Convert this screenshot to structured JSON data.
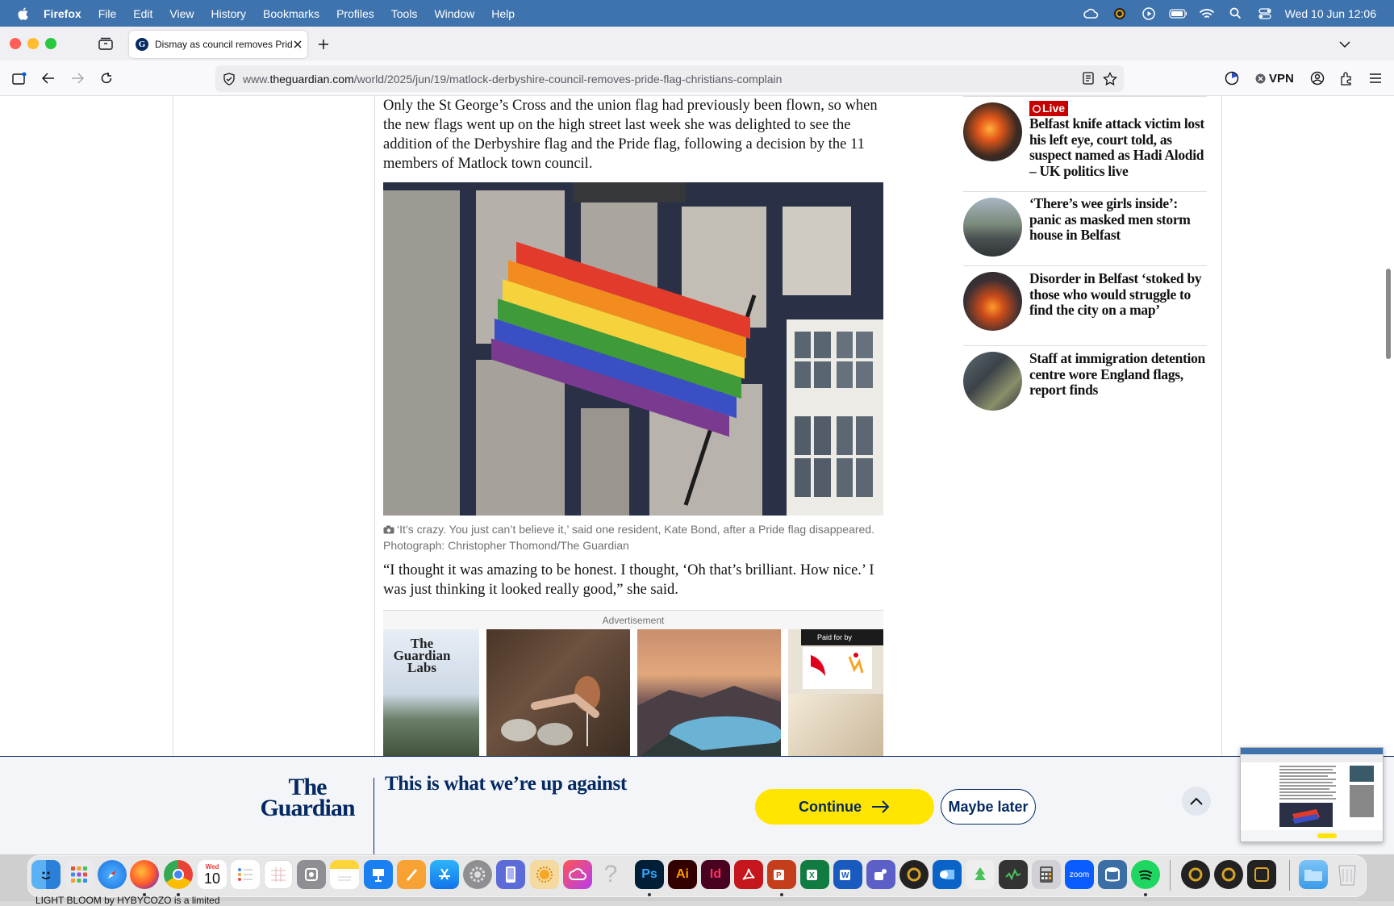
{
  "menubar": {
    "app": "Firefox",
    "items": [
      "File",
      "Edit",
      "View",
      "History",
      "Bookmarks",
      "Profiles",
      "Tools",
      "Window",
      "Help"
    ],
    "clock": "Wed 10 Jun  12:06"
  },
  "browser": {
    "tab_title": "Dismay as council removes Pride flag",
    "url_prefix": "www.",
    "url_domain": "theguardian.com",
    "url_path": "/world/2025/jun/19/matlock-derbyshire-council-removes-pride-flag-christians-complain",
    "vpn_label": "VPN"
  },
  "article": {
    "para1": "Only the St George’s Cross and the union flag had previously been flown, so when the new flags went up on the high street last week she was delighted to see the addition of the Derbyshire flag and the Pride flag, following a decision by the 11 members of Matlock town council.",
    "caption": "‘It’s crazy. You just can’t believe it,’ said one resident, Kate Bond, after a Pride flag disappeared. Photograph: Christopher Thomond/The Guardian",
    "para2": "“I thought it was amazing to be honest. I thought, ‘Oh that’s brilliant. How nice.’ I was just thinking it looked really good,” she said.",
    "ad_label": "Advertisement",
    "ad_logo": "The Guardian Labs",
    "ad_paid": "Paid for by"
  },
  "related": [
    {
      "badge": "Live",
      "headline": "Belfast knife attack victim lost his left eye, court told, as suspect named as Hadi Alodid – UK politics live"
    },
    {
      "headline": "‘There’s wee girls inside’: panic as masked men storm house in Belfast"
    },
    {
      "headline": "Disorder in Belfast ‘stoked by those who would struggle to find the city on a map’"
    },
    {
      "headline": "Staff at immigration detention centre wore England flags, report finds"
    }
  ],
  "banner": {
    "logo": "The Guardian",
    "headline": "This is what we’re up against",
    "continue": "Continue",
    "later": "Maybe later"
  },
  "dock": {
    "calendar_month": "Wed",
    "calendar_day": "10",
    "ps": "Ps",
    "ai": "Ai",
    "id": "Id",
    "zoom": "zoom"
  },
  "bottom_text": "LIGHT BLOOM by HYBYCOZO is a limited",
  "colors": {
    "guardian_blue": "#052962",
    "live_red": "#c70000",
    "cta_yellow": "#ffe500",
    "menubar_blue": "#3f73ad"
  }
}
